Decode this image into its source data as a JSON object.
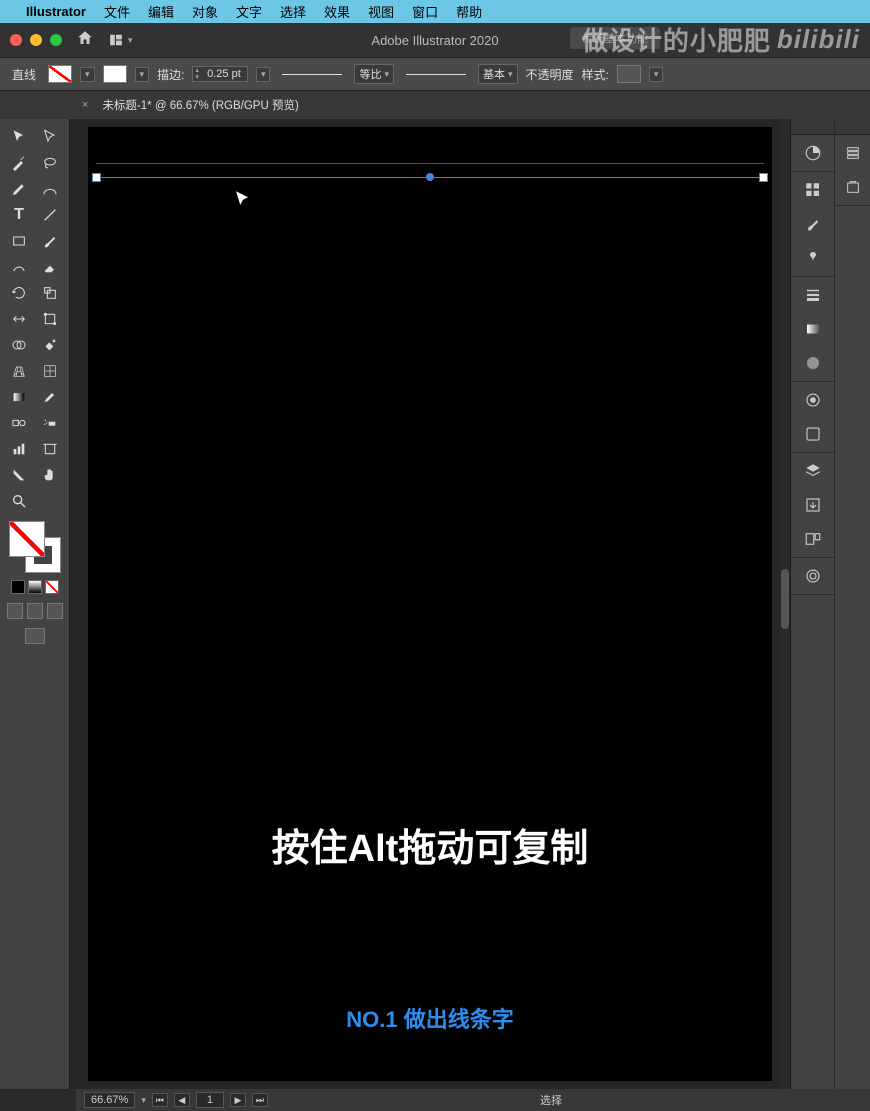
{
  "menubar": {
    "app": "Illustrator",
    "items": [
      "文件",
      "编辑",
      "对象",
      "文字",
      "选择",
      "效果",
      "视图",
      "窗口",
      "帮助"
    ]
  },
  "appbar": {
    "title": "Adobe Illustrator 2020",
    "workspace": "传统基本功能",
    "watermark_text": "做设计的小肥肥",
    "watermark_brand": "bilibili"
  },
  "controlbar": {
    "object_type": "直线",
    "stroke_label": "描边:",
    "stroke_weight": "0.25 pt",
    "profile_label": "等比",
    "brush_label": "基本",
    "opacity_label": "不透明度",
    "style_label": "样式:"
  },
  "tab": {
    "label": "未标题-1* @ 66.67% (RGB/GPU 预览)"
  },
  "canvas": {
    "big_caption": "按住Alt拖动可复制",
    "sub_caption": "NO.1 做出线条字"
  },
  "statusbar": {
    "zoom": "66.67%",
    "artboard_num": "1",
    "selection": "选择"
  },
  "icons": {
    "home": "⌂"
  }
}
